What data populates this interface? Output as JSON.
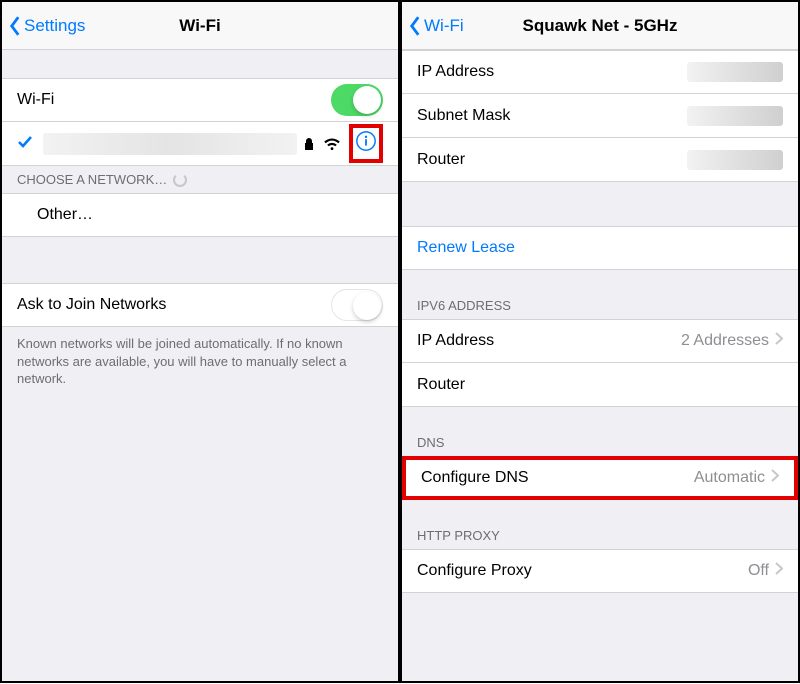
{
  "left": {
    "back": "Settings",
    "title": "Wi-Fi",
    "wifi_toggle_label": "Wi-Fi",
    "choose_header": "Choose a Network…",
    "other": "Other…",
    "ask_label": "Ask to Join Networks",
    "ask_footer": "Known networks will be joined automatically. If no known networks are available, you will have to manually select a network."
  },
  "right": {
    "back": "Wi-Fi",
    "title": "Squawk Net - 5GHz",
    "ip_label": "IP Address",
    "subnet_label": "Subnet Mask",
    "router_label": "Router",
    "renew": "Renew Lease",
    "ipv6_header": "IPv6 Address",
    "ipv6_ip_label": "IP Address",
    "ipv6_ip_value": "2 Addresses",
    "ipv6_router_label": "Router",
    "dns_header": "DNS",
    "dns_label": "Configure DNS",
    "dns_value": "Automatic",
    "proxy_header": "HTTP Proxy",
    "proxy_label": "Configure Proxy",
    "proxy_value": "Off"
  }
}
